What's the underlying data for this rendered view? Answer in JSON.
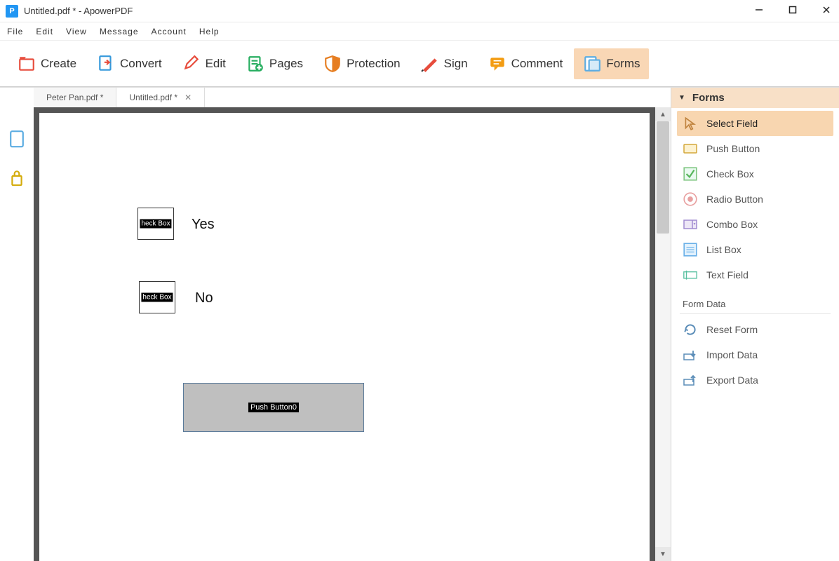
{
  "title": "Untitled.pdf * - ApowerPDF",
  "app_icon_letter": "P",
  "menubar": [
    "File",
    "Edit",
    "View",
    "Message",
    "Account",
    "Help"
  ],
  "toolbar": [
    {
      "label": "Create"
    },
    {
      "label": "Convert"
    },
    {
      "label": "Edit"
    },
    {
      "label": "Pages"
    },
    {
      "label": "Protection"
    },
    {
      "label": "Sign"
    },
    {
      "label": "Comment"
    },
    {
      "label": "Forms"
    }
  ],
  "toolbar_active_index": 7,
  "doc_tabs": [
    {
      "label": "Peter Pan.pdf *",
      "closable": false,
      "active": false
    },
    {
      "label": "Untitled.pdf *",
      "closable": true,
      "active": true
    }
  ],
  "page_fields": {
    "check1_label": "heck Box",
    "check1_text": "Yes",
    "check2_label": "heck Box",
    "check2_text": "No",
    "push_label": "Push Button0"
  },
  "side_panel": {
    "header": "Forms",
    "tools": [
      {
        "label": "Select Field"
      },
      {
        "label": "Push Button"
      },
      {
        "label": "Check Box"
      },
      {
        "label": "Radio Button"
      },
      {
        "label": "Combo Box"
      },
      {
        "label": "List Box"
      },
      {
        "label": "Text Field"
      }
    ],
    "tools_active_index": 0,
    "section2_label": "Form Data",
    "data_tools": [
      {
        "label": "Reset Form"
      },
      {
        "label": "Import Data"
      },
      {
        "label": "Export Data"
      }
    ]
  }
}
